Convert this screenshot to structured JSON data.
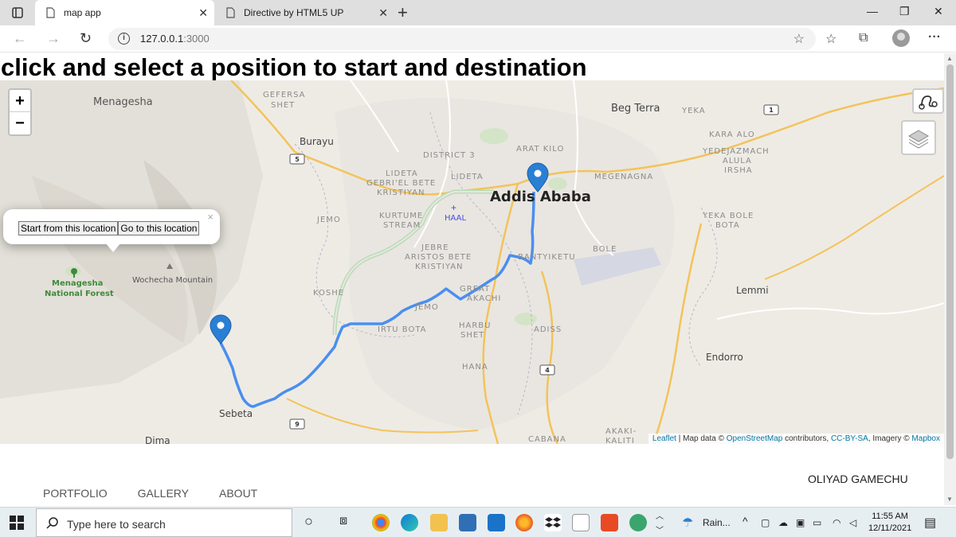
{
  "browser": {
    "tabs": [
      {
        "title": "map app",
        "active": true
      },
      {
        "title": "Directive by HTML5 UP",
        "active": false
      }
    ],
    "url_host": "127.0.0.1",
    "url_port": ":3000"
  },
  "page": {
    "heading": "click and select a position to start and destination"
  },
  "map": {
    "zoom_in": "+",
    "zoom_out": "−",
    "popup": {
      "start_label": "Start from this location",
      "go_label": "Go to this location",
      "close": "×"
    },
    "labels": {
      "menagesha": "Menagesha",
      "gefersa": "GEFERSA",
      "shet": "SHET",
      "burayu": "Burayu",
      "district3": "DISTRICT 3",
      "arat_kilo": "ARAT KILO",
      "beg_terra": "Beg Terra",
      "yeka": "YEKA",
      "kara_alo": "KARA ALO",
      "yedejazmach": "YEDEJAZMACH",
      "alula": "ALULA",
      "irsha": "IRSHA",
      "lideta1": "LIDETA",
      "gebri": "GEBRI'EL BETE",
      "kristiyan": "KRISTIYAN",
      "lideta2": "LIDETA",
      "addis_ababa": "Addis Ababa",
      "megenagna": "MEGENAGNA",
      "jemo": "JEMO",
      "kurtume": "KURTUME",
      "stream": "STREAM",
      "haal": "HAAL",
      "yeka_bole": "YEKA BOLE",
      "bota": "BOTA",
      "jebre": "JEBRE",
      "aristos": "ARISTOS BETE",
      "kristiyan2": "KRISTIYAN",
      "bantyiketu": "BANTYIKETU",
      "bole": "BOLE",
      "menagesha_forest": "Menagesha",
      "national_forest": "National Forest",
      "wochecha": "Wochecha Mountain",
      "koshe": "KOSHE",
      "great": "GREAT",
      "akachi": "AKACHI",
      "lemmi": "Lemmi",
      "jemo2": "JEMO",
      "irtu_bota": "IRTU BOTA",
      "harbu": "HARBU",
      "shet2": "SHET",
      "adiss": "ADISS",
      "endorro": "Endorro",
      "hana": "HANA",
      "sebeta": "Sebeta",
      "dima": "Dima",
      "cabana": "CABANA",
      "akaki": "AKAKI-",
      "kaliti": "KALITI",
      "road1": "1",
      "road5": "5",
      "road4": "4",
      "road9": "9"
    },
    "attribution": {
      "leaflet": "Leaflet",
      "sep1": " | Map data © ",
      "osm": "OpenStreetMap",
      "sep2": " contributors, ",
      "license": "CC-BY-SA",
      "sep3": ", Imagery © ",
      "mapbox": "Mapbox"
    }
  },
  "footer": {
    "nav": [
      "PORTFOLIO",
      "GALLERY",
      "ABOUT"
    ],
    "name": "OLIYAD GAMECHU"
  },
  "taskbar": {
    "search_placeholder": "Type here to search",
    "weather": "Rain...",
    "time": "11:55 AM",
    "date": "12/11/2021"
  }
}
